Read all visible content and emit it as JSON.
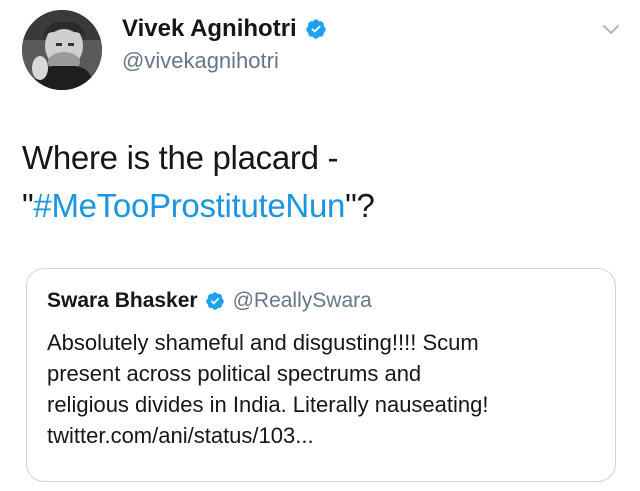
{
  "author": {
    "name": "Vivek Agnihotri",
    "handle": "@vivekagnihotri",
    "verified_icon": "verified-badge-icon"
  },
  "menu": {
    "icon": "chevron-down-icon"
  },
  "tweet": {
    "line1": "Where is the placard -",
    "open_quote": "\"",
    "hashtag": "#MeTooProstituteNun",
    "close_quote": "\"?"
  },
  "quoted": {
    "name": "Swara Bhasker",
    "handle": "@ReallySwara",
    "verified_icon": "verified-badge-icon",
    "body_lines": [
      "Absolutely shameful and disgusting!!!! Scum",
      "present across political spectrums and",
      "religious divides in India. Literally nauseating!",
      "twitter.com/ani/status/103..."
    ]
  },
  "colors": {
    "verified": "#1da1f2",
    "hashtag": "#1b95e0",
    "secondary_text": "#657786",
    "border": "#ccd6dd"
  }
}
